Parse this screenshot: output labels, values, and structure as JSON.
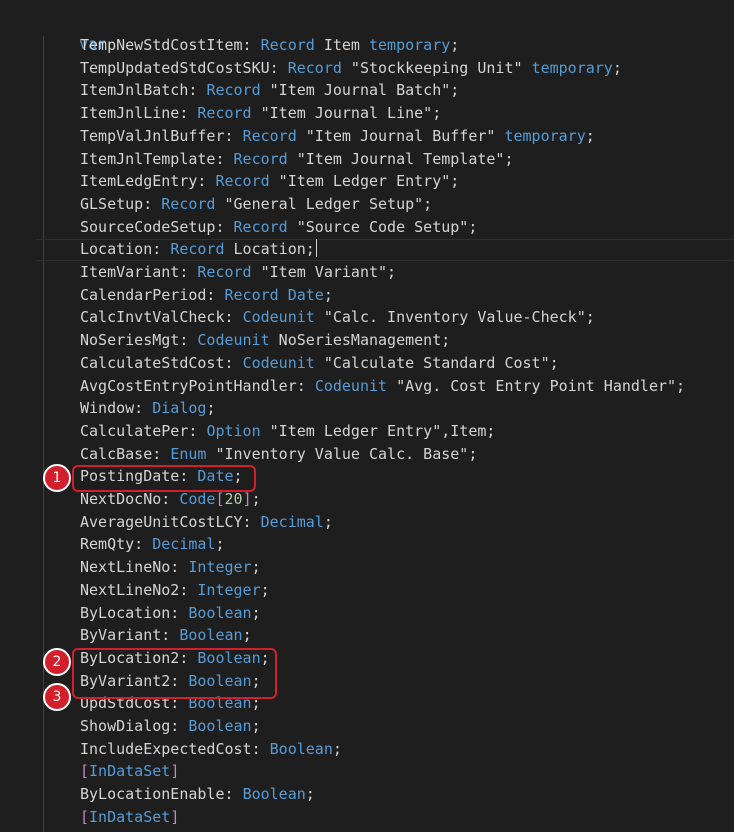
{
  "editor": {
    "keyword_var": "var",
    "lines": [
      [
        {
          "t": "TempNewStdCostItem: ",
          "c": "id"
        },
        {
          "t": "Record",
          "c": "kw"
        },
        {
          "t": " Item ",
          "c": "id"
        },
        {
          "t": "temporary",
          "c": "kw"
        },
        {
          "t": ";",
          "c": "id"
        }
      ],
      [
        {
          "t": "TempUpdatedStdCostSKU: ",
          "c": "id"
        },
        {
          "t": "Record",
          "c": "kw"
        },
        {
          "t": " \"Stockkeeping Unit\" ",
          "c": "id"
        },
        {
          "t": "temporary",
          "c": "kw"
        },
        {
          "t": ";",
          "c": "id"
        }
      ],
      [
        {
          "t": "ItemJnlBatch: ",
          "c": "id"
        },
        {
          "t": "Record",
          "c": "kw"
        },
        {
          "t": " \"Item Journal Batch\";",
          "c": "id"
        }
      ],
      [
        {
          "t": "ItemJnlLine: ",
          "c": "id"
        },
        {
          "t": "Record",
          "c": "kw"
        },
        {
          "t": " \"Item Journal Line\";",
          "c": "id"
        }
      ],
      [
        {
          "t": "TempValJnlBuffer: ",
          "c": "id"
        },
        {
          "t": "Record",
          "c": "kw"
        },
        {
          "t": " \"Item Journal Buffer\" ",
          "c": "id"
        },
        {
          "t": "temporary",
          "c": "kw"
        },
        {
          "t": ";",
          "c": "id"
        }
      ],
      [
        {
          "t": "ItemJnlTemplate: ",
          "c": "id"
        },
        {
          "t": "Record",
          "c": "kw"
        },
        {
          "t": " \"Item Journal Template\";",
          "c": "id"
        }
      ],
      [
        {
          "t": "ItemLedgEntry: ",
          "c": "id"
        },
        {
          "t": "Record",
          "c": "kw"
        },
        {
          "t": " \"Item Ledger Entry\";",
          "c": "id"
        }
      ],
      [
        {
          "t": "GLSetup: ",
          "c": "id"
        },
        {
          "t": "Record",
          "c": "kw"
        },
        {
          "t": " \"General Ledger Setup\";",
          "c": "id"
        }
      ],
      [
        {
          "t": "SourceCodeSetup: ",
          "c": "id"
        },
        {
          "t": "Record",
          "c": "kw"
        },
        {
          "t": " \"Source Code Setup\";",
          "c": "id"
        }
      ],
      [
        {
          "t": "Location: ",
          "c": "id"
        },
        {
          "t": "Record",
          "c": "kw"
        },
        {
          "t": " Location;",
          "c": "id"
        }
      ],
      [
        {
          "t": "ItemVariant: ",
          "c": "id"
        },
        {
          "t": "Record",
          "c": "kw"
        },
        {
          "t": " \"Item Variant\";",
          "c": "id"
        }
      ],
      [
        {
          "t": "CalendarPeriod: ",
          "c": "id"
        },
        {
          "t": "Record Date",
          "c": "kw"
        },
        {
          "t": ";",
          "c": "id"
        }
      ],
      [
        {
          "t": "CalcInvtValCheck: ",
          "c": "id"
        },
        {
          "t": "Codeunit",
          "c": "kw"
        },
        {
          "t": " \"Calc. Inventory Value-Check\";",
          "c": "id"
        }
      ],
      [
        {
          "t": "NoSeriesMgt: ",
          "c": "id"
        },
        {
          "t": "Codeunit",
          "c": "kw"
        },
        {
          "t": " NoSeriesManagement;",
          "c": "id"
        }
      ],
      [
        {
          "t": "CalculateStdCost: ",
          "c": "id"
        },
        {
          "t": "Codeunit",
          "c": "kw"
        },
        {
          "t": " \"Calculate Standard Cost\";",
          "c": "id"
        }
      ],
      [
        {
          "t": "AvgCostEntryPointHandler: ",
          "c": "id"
        },
        {
          "t": "Codeunit",
          "c": "kw"
        },
        {
          "t": " \"Avg. Cost Entry Point Handler\";",
          "c": "id"
        }
      ],
      [
        {
          "t": "Window: ",
          "c": "id"
        },
        {
          "t": "Dialog",
          "c": "kw"
        },
        {
          "t": ";",
          "c": "id"
        }
      ],
      [
        {
          "t": "CalculatePer: ",
          "c": "id"
        },
        {
          "t": "Option",
          "c": "kw"
        },
        {
          "t": " \"Item Ledger Entry\",Item;",
          "c": "id"
        }
      ],
      [
        {
          "t": "CalcBase: ",
          "c": "id"
        },
        {
          "t": "Enum",
          "c": "kw"
        },
        {
          "t": " \"Inventory Value Calc. Base\";",
          "c": "id"
        }
      ],
      [
        {
          "t": "PostingDate: ",
          "c": "id"
        },
        {
          "t": "Date",
          "c": "kw"
        },
        {
          "t": ";",
          "c": "id"
        }
      ],
      [
        {
          "t": "NextDocNo: ",
          "c": "id"
        },
        {
          "t": "Code",
          "c": "kw"
        },
        {
          "t": "[",
          "c": "brk"
        },
        {
          "t": "20",
          "c": "num"
        },
        {
          "t": "]",
          "c": "brk"
        },
        {
          "t": ";",
          "c": "id"
        }
      ],
      [
        {
          "t": "AverageUnitCostLCY: ",
          "c": "id"
        },
        {
          "t": "Decimal",
          "c": "kw"
        },
        {
          "t": ";",
          "c": "id"
        }
      ],
      [
        {
          "t": "RemQty: ",
          "c": "id"
        },
        {
          "t": "Decimal",
          "c": "kw"
        },
        {
          "t": ";",
          "c": "id"
        }
      ],
      [
        {
          "t": "NextLineNo: ",
          "c": "id"
        },
        {
          "t": "Integer",
          "c": "kw"
        },
        {
          "t": ";",
          "c": "id"
        }
      ],
      [
        {
          "t": "NextLineNo2: ",
          "c": "id"
        },
        {
          "t": "Integer",
          "c": "kw"
        },
        {
          "t": ";",
          "c": "id"
        }
      ],
      [
        {
          "t": "ByLocation: ",
          "c": "id"
        },
        {
          "t": "Boolean",
          "c": "kw"
        },
        {
          "t": ";",
          "c": "id"
        }
      ],
      [
        {
          "t": "ByVariant: ",
          "c": "id"
        },
        {
          "t": "Boolean",
          "c": "kw"
        },
        {
          "t": ";",
          "c": "id"
        }
      ],
      [
        {
          "t": "ByLocation2: ",
          "c": "id"
        },
        {
          "t": "Boolean",
          "c": "kw"
        },
        {
          "t": ";",
          "c": "id"
        }
      ],
      [
        {
          "t": "ByVariant2: ",
          "c": "id"
        },
        {
          "t": "Boolean",
          "c": "kw"
        },
        {
          "t": ";",
          "c": "id"
        }
      ],
      [
        {
          "t": "UpdStdCost: ",
          "c": "id"
        },
        {
          "t": "Boolean",
          "c": "kw"
        },
        {
          "t": ";",
          "c": "id"
        }
      ],
      [
        {
          "t": "ShowDialog: ",
          "c": "id"
        },
        {
          "t": "Boolean",
          "c": "kw"
        },
        {
          "t": ";",
          "c": "id"
        }
      ],
      [
        {
          "t": "IncludeExpectedCost: ",
          "c": "id"
        },
        {
          "t": "Boolean",
          "c": "kw"
        },
        {
          "t": ";",
          "c": "id"
        }
      ],
      [
        {
          "t": "[",
          "c": "brk"
        },
        {
          "t": "InDataSet",
          "c": "kw"
        },
        {
          "t": "]",
          "c": "brk"
        }
      ],
      [
        {
          "t": "ByLocationEnable: ",
          "c": "id"
        },
        {
          "t": "Boolean",
          "c": "kw"
        },
        {
          "t": ";",
          "c": "id"
        }
      ],
      [
        {
          "t": "[",
          "c": "brk"
        },
        {
          "t": "InDataSet",
          "c": "kw"
        },
        {
          "t": "]",
          "c": "brk"
        }
      ]
    ],
    "cursor_line": 9
  },
  "annotations": [
    {
      "label": "1"
    },
    {
      "label": "2"
    },
    {
      "label": "3"
    }
  ],
  "colors": {
    "background": "#1e1e1e",
    "keyword": "#569cd6",
    "identifier": "#d4d4d4",
    "number": "#b5cea8",
    "bracket": "#c586c0",
    "annotation": "#d21f2b"
  }
}
